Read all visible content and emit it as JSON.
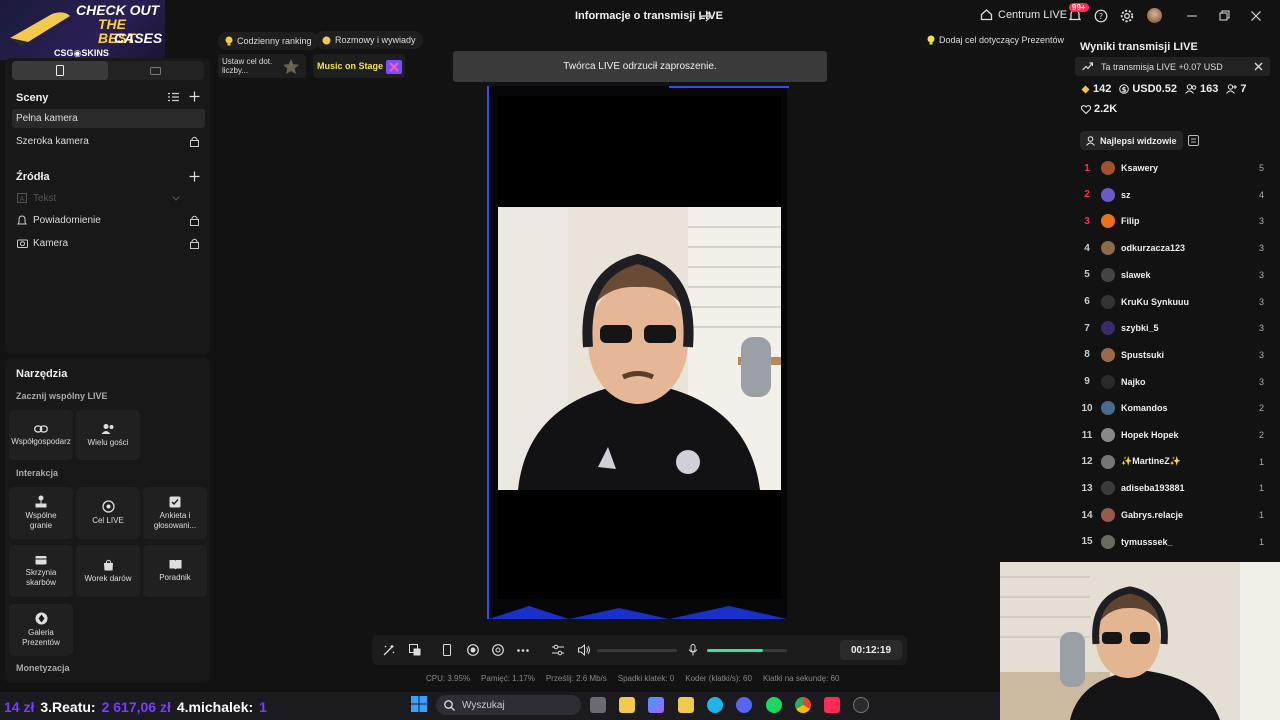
{
  "window": {
    "title": "Informacje o transmisji LIVE",
    "centrum_label": "Centrum LIVE",
    "notif_badge": "99+"
  },
  "ad": {
    "line1": "CHECK OUT",
    "line2": "THE BEST",
    "line3": "CASES",
    "brand": "CSG◉SKINS"
  },
  "left": {
    "scenes_title": "Sceny",
    "scenes": [
      "Pełna kamera",
      "Szeroka kamera"
    ],
    "sources_title": "Źródła",
    "sources": [
      "Tekst",
      "Powiadomienie",
      "Kamera"
    ],
    "tools_title": "Narzędzia",
    "group1": "Zacznij wspólny LIVE",
    "group1_tools": [
      "Współgospodarz",
      "Wielu gości"
    ],
    "group2": "Interakcja",
    "group2_tools": [
      "Wspólne granie",
      "Cel LIVE",
      "Ankieta i głosowani...",
      "Skrzynia skarbów",
      "Worek darów",
      "Poradnik",
      "Galeria Prezentów"
    ],
    "group3": "Monetyzacja"
  },
  "chips": {
    "ranking": "Codzienny ranking",
    "talks": "Rozmowy i wywiady",
    "goal_card": "Ustaw cel dot. liczby...",
    "music": "Music on Stage",
    "gift_goal": "Dodaj cel dotyczący Prezentów"
  },
  "toast": "Twórca LIVE odrzucił zaproszenie.",
  "controls": {
    "timer": "00:12:19",
    "volume_level": 0.0,
    "mic_level": 0.7
  },
  "stats": [
    "CPU: 3.95%",
    "Pamięć: 1.17%",
    "Prześlij: 2.6 Mb/s",
    "Spadki klatek: 0",
    "Koder (klatki/s): 60",
    "Klatki na sekundę: 60"
  ],
  "right": {
    "title": "Wyniki transmisji LIVE",
    "earnings": "Ta transmisja LIVE +0.07 USD",
    "metrics": {
      "diamonds": "142",
      "usd": "USD0.52",
      "viewers": "163",
      "follows": "7",
      "likes": "2.2K"
    },
    "tab_label": "Najlepsi widzowie",
    "viewers": [
      {
        "rank": "1",
        "name": "Ksawery",
        "score": "5",
        "color": "#a0522d"
      },
      {
        "rank": "2",
        "name": "sz",
        "score": "4",
        "color": "#6a5acd"
      },
      {
        "rank": "3",
        "name": "Filip",
        "score": "3",
        "color": "#e8731b"
      },
      {
        "rank": "4",
        "name": "odkurzacza123",
        "score": "3",
        "color": "#8b6b4a"
      },
      {
        "rank": "5",
        "name": "slawek",
        "score": "3",
        "color": "#444"
      },
      {
        "rank": "6",
        "name": "KruKu Synkuuu",
        "score": "3",
        "color": "#333"
      },
      {
        "rank": "7",
        "name": "szybki_5",
        "score": "3",
        "color": "#3b2a6a"
      },
      {
        "rank": "8",
        "name": "Spustsuki",
        "score": "3",
        "color": "#9a6a4a"
      },
      {
        "rank": "9",
        "name": "Najko",
        "score": "3",
        "color": "#2a2a2a"
      },
      {
        "rank": "10",
        "name": "Komandos",
        "score": "2",
        "color": "#4a6a8a"
      },
      {
        "rank": "11",
        "name": "Hopek Hopek",
        "score": "2",
        "color": "#888"
      },
      {
        "rank": "12",
        "name": "✨MartineZ✨",
        "score": "1",
        "color": "#777"
      },
      {
        "rank": "13",
        "name": "adiseba193881",
        "score": "1",
        "color": "#3a3a3a"
      },
      {
        "rank": "14",
        "name": "Gabrys.relacje",
        "score": "1",
        "color": "#9a5a4a"
      },
      {
        "rank": "15",
        "name": "tymusssek_",
        "score": "1",
        "color": "#6a6a5a"
      }
    ]
  },
  "taskbar": {
    "ticker": {
      "p1": "14 zł",
      "p2": "3.Reatu:",
      "p3": "2 617,06 zł",
      "p4": "4.michalek:",
      "p5": "1"
    },
    "search_placeholder": "Wyszukaj"
  }
}
